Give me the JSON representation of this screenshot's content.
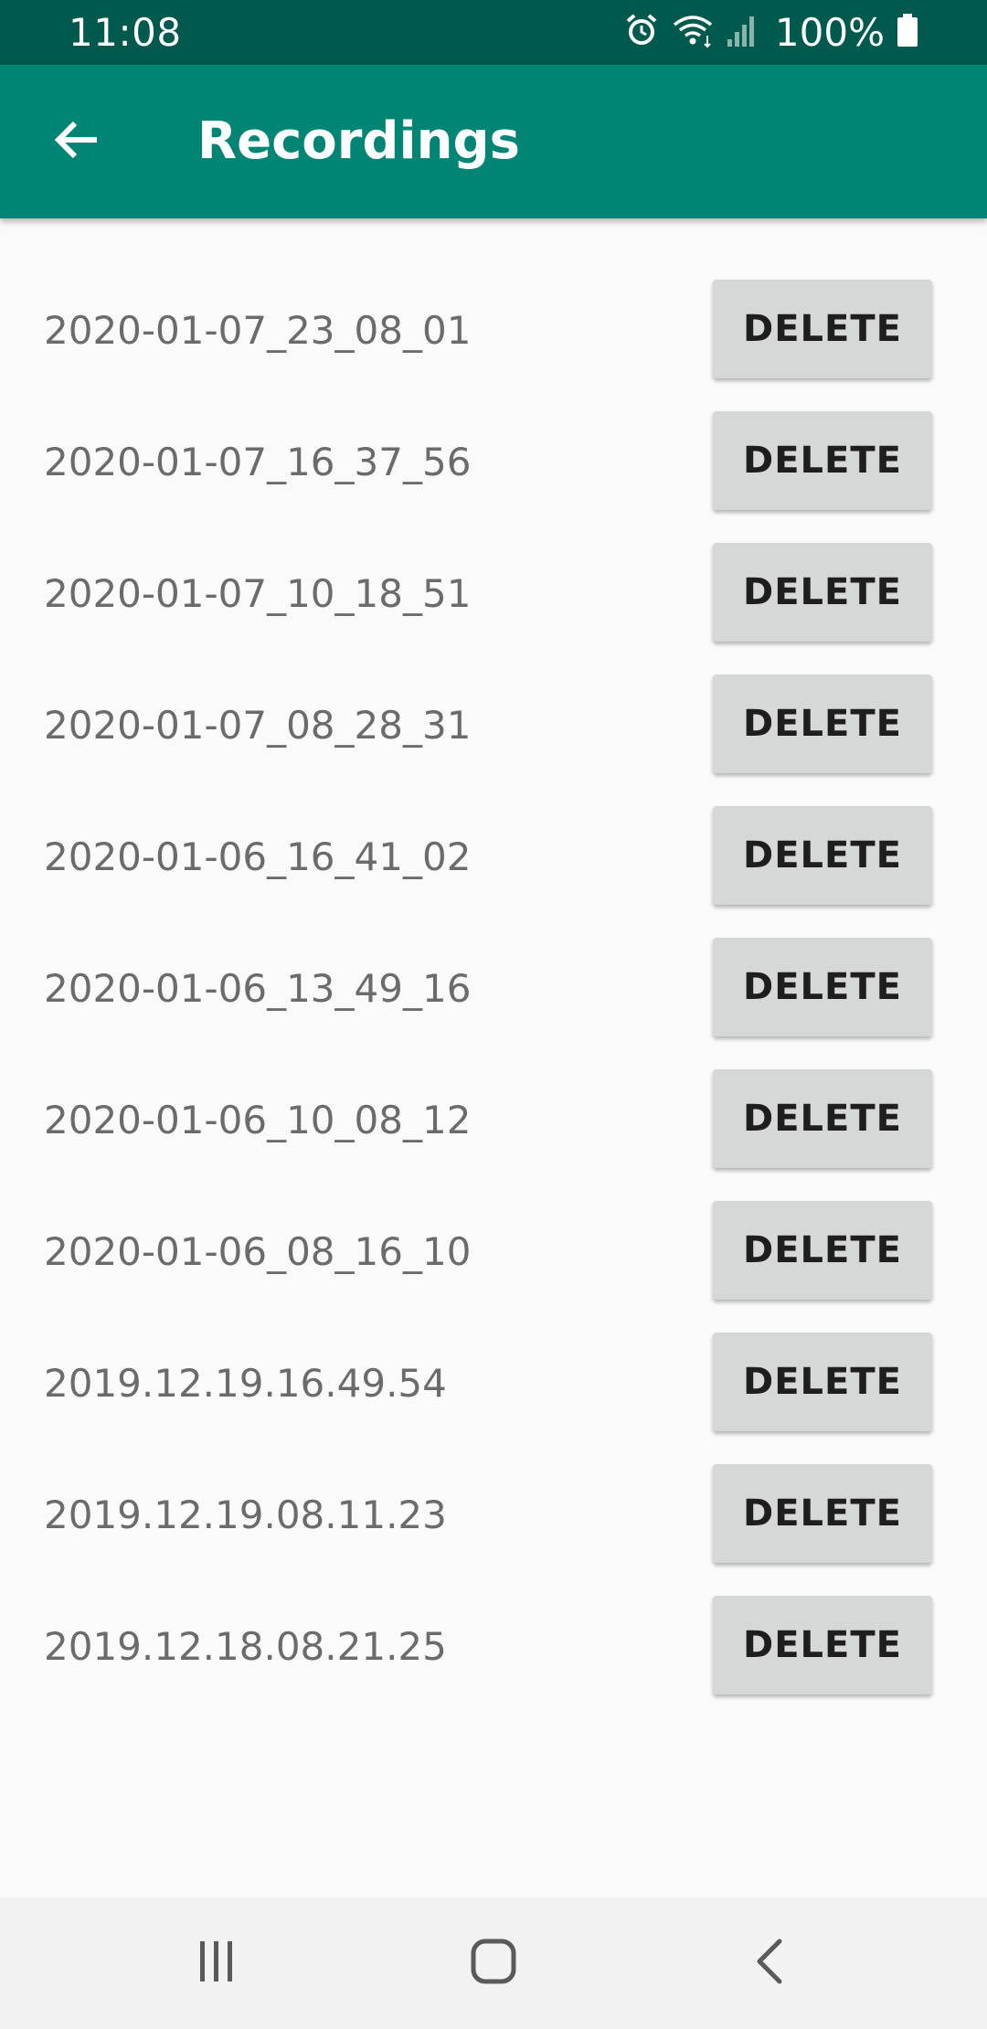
{
  "status_bar": {
    "time": "11:08",
    "battery_percent": "100%",
    "icons": [
      "alarm-icon",
      "wifi-icon",
      "signal-icon",
      "battery-icon"
    ]
  },
  "app_bar": {
    "title": "Recordings",
    "back_icon": "arrow-back-icon",
    "color": "#008575"
  },
  "recordings": [
    {
      "name": "2020-01-07_23_08_01",
      "action": "DELETE"
    },
    {
      "name": "2020-01-07_16_37_56",
      "action": "DELETE"
    },
    {
      "name": "2020-01-07_10_18_51",
      "action": "DELETE"
    },
    {
      "name": "2020-01-07_08_28_31",
      "action": "DELETE"
    },
    {
      "name": "2020-01-06_16_41_02",
      "action": "DELETE"
    },
    {
      "name": "2020-01-06_13_49_16",
      "action": "DELETE"
    },
    {
      "name": "2020-01-06_10_08_12",
      "action": "DELETE"
    },
    {
      "name": "2020-01-06_08_16_10",
      "action": "DELETE"
    },
    {
      "name": "2019.12.19.16.49.54",
      "action": "DELETE"
    },
    {
      "name": "2019.12.19.08.11.23",
      "action": "DELETE"
    },
    {
      "name": "2019.12.18.08.21.25",
      "action": "DELETE"
    }
  ],
  "nav_bar": {
    "icons": [
      "recent-apps-icon",
      "home-icon",
      "back-nav-icon"
    ]
  }
}
